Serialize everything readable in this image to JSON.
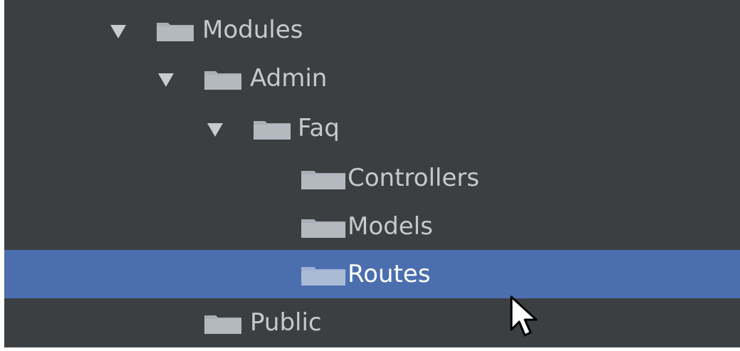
{
  "tree": {
    "items": [
      {
        "label": "Modules",
        "depth": 0,
        "expanded": true,
        "selected": false
      },
      {
        "label": "Admin",
        "depth": 1,
        "expanded": true,
        "selected": false
      },
      {
        "label": "Faq",
        "depth": 2,
        "expanded": true,
        "selected": false
      },
      {
        "label": "Controllers",
        "depth": 3,
        "expanded": false,
        "selected": false
      },
      {
        "label": "Models",
        "depth": 3,
        "expanded": false,
        "selected": false
      },
      {
        "label": "Routes",
        "depth": 3,
        "expanded": false,
        "selected": true
      },
      {
        "label": "Public",
        "depth": 1,
        "expanded": false,
        "selected": false
      }
    ]
  },
  "colors": {
    "background": "#3c3f41",
    "selection": "#4b6eaf",
    "text": "#c7c9cb",
    "folder": "#a9afb5"
  },
  "icons": {
    "expand": "triangle-down-icon",
    "folder": "folder-icon",
    "cursor": "mouse-pointer-icon"
  }
}
